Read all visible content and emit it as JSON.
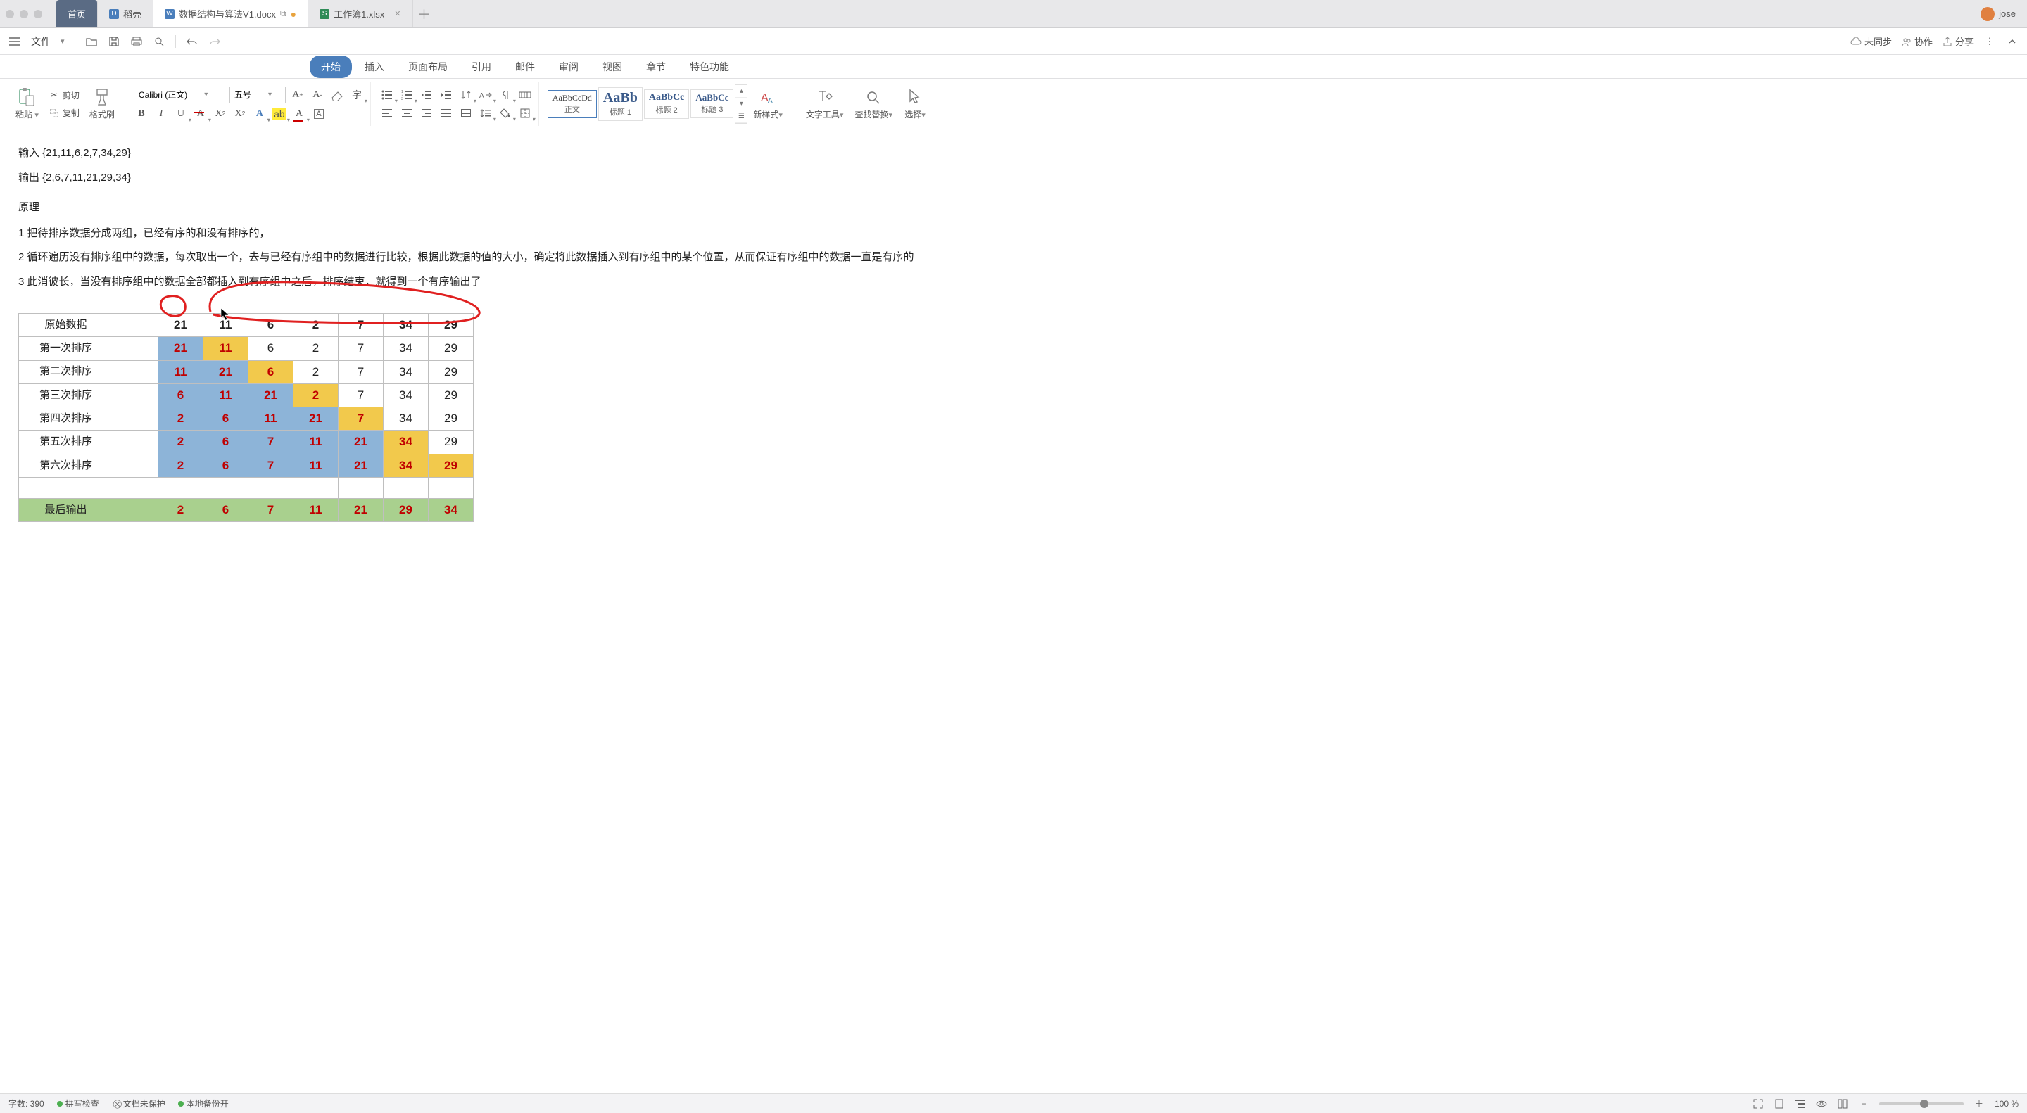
{
  "titlebar": {
    "tabs": {
      "home": "首页",
      "dao": "稻壳",
      "doc": "数据结构与算法V1.docx",
      "sheet": "工作簿1.xlsx"
    },
    "user": "jose"
  },
  "menubar": {
    "file": "文件",
    "sync": "未同步",
    "collab": "协作",
    "share": "分享"
  },
  "ribbon": {
    "tabs": {
      "start": "开始",
      "insert": "插入",
      "layout": "页面布局",
      "ref": "引用",
      "mail": "邮件",
      "review": "审阅",
      "view": "视图",
      "chapter": "章节",
      "special": "特色功能"
    },
    "paste": "粘贴",
    "cut": "剪切",
    "copy": "复制",
    "brush": "格式刷",
    "font_name": "Calibri (正文)",
    "font_size": "五号",
    "styles": {
      "s1": {
        "prev": "AaBbCcDd",
        "label": "正文"
      },
      "s2": {
        "prev": "AaBb",
        "label": "标题 1"
      },
      "s3": {
        "prev": "AaBbCc",
        "label": "标题 2"
      },
      "s4": {
        "prev": "AaBbCc",
        "label": "标题 3"
      }
    },
    "newstyle": "新样式",
    "texttool": "文字工具",
    "findrep": "查找替换",
    "select": "选择"
  },
  "doc": {
    "p_input": "输入  {21,11,6,2,7,34,29}",
    "p_output": "输出  {2,6,7,11,21,29,34}",
    "p_principle": "原理",
    "p1": "1  把待排序数据分成两组，已经有序的和没有排序的，",
    "p2": "2  循环遍历没有排序组中的数据，每次取出一个，去与已经有序组中的数据进行比较，根据此数据的值的大小，确定将此数据插入到有序组中的某个位置，从而保证有序组中的数据一直是有序的",
    "p3": "3  此消彼长，当没有排序组中的数据全部都插入到有序组中之后，排序结束，就得到一个有序输出了",
    "table": {
      "rowh": [
        "原始数据",
        "第一次排序",
        "第二次排序",
        "第三次排序",
        "第四次排序",
        "第五次排序",
        "第六次排序",
        "",
        "最后输出"
      ],
      "rows": [
        [
          {
            "v": "21"
          },
          {
            "v": "11"
          },
          {
            "v": "6"
          },
          {
            "v": "2"
          },
          {
            "v": "7"
          },
          {
            "v": "34"
          },
          {
            "v": "29"
          }
        ],
        [
          {
            "v": "21",
            "bg": "blue",
            "c": "red"
          },
          {
            "v": "11",
            "bg": "yellow",
            "c": "red"
          },
          {
            "v": "6"
          },
          {
            "v": "2"
          },
          {
            "v": "7"
          },
          {
            "v": "34"
          },
          {
            "v": "29"
          }
        ],
        [
          {
            "v": "11",
            "bg": "blue",
            "c": "red"
          },
          {
            "v": "21",
            "bg": "blue",
            "c": "red"
          },
          {
            "v": "6",
            "bg": "yellow",
            "c": "red"
          },
          {
            "v": "2"
          },
          {
            "v": "7"
          },
          {
            "v": "34"
          },
          {
            "v": "29"
          }
        ],
        [
          {
            "v": "6",
            "bg": "blue",
            "c": "red"
          },
          {
            "v": "11",
            "bg": "blue",
            "c": "red"
          },
          {
            "v": "21",
            "bg": "blue",
            "c": "red"
          },
          {
            "v": "2",
            "bg": "yellow",
            "c": "red"
          },
          {
            "v": "7"
          },
          {
            "v": "34"
          },
          {
            "v": "29"
          }
        ],
        [
          {
            "v": "2",
            "bg": "blue",
            "c": "red"
          },
          {
            "v": "6",
            "bg": "blue",
            "c": "red"
          },
          {
            "v": "11",
            "bg": "blue",
            "c": "red"
          },
          {
            "v": "21",
            "bg": "blue",
            "c": "red"
          },
          {
            "v": "7",
            "bg": "yellow",
            "c": "red"
          },
          {
            "v": "34"
          },
          {
            "v": "29"
          }
        ],
        [
          {
            "v": "2",
            "bg": "blue",
            "c": "red"
          },
          {
            "v": "6",
            "bg": "blue",
            "c": "red"
          },
          {
            "v": "7",
            "bg": "blue",
            "c": "red"
          },
          {
            "v": "11",
            "bg": "blue",
            "c": "red"
          },
          {
            "v": "21",
            "bg": "blue",
            "c": "red"
          },
          {
            "v": "34",
            "bg": "yellow",
            "c": "red"
          },
          {
            "v": "29"
          }
        ],
        [
          {
            "v": "2",
            "bg": "blue",
            "c": "red"
          },
          {
            "v": "6",
            "bg": "blue",
            "c": "red"
          },
          {
            "v": "7",
            "bg": "blue",
            "c": "red"
          },
          {
            "v": "11",
            "bg": "blue",
            "c": "red"
          },
          {
            "v": "21",
            "bg": "blue",
            "c": "red"
          },
          {
            "v": "34",
            "bg": "yellow",
            "c": "red"
          },
          {
            "v": "29",
            "bg": "yellow",
            "c": "red"
          }
        ],
        [
          {
            "v": ""
          },
          {
            "v": ""
          },
          {
            "v": ""
          },
          {
            "v": ""
          },
          {
            "v": ""
          },
          {
            "v": ""
          },
          {
            "v": ""
          }
        ],
        [
          {
            "v": "2",
            "bg": "green",
            "c": "red"
          },
          {
            "v": "6",
            "bg": "green",
            "c": "red"
          },
          {
            "v": "7",
            "bg": "green",
            "c": "red"
          },
          {
            "v": "11",
            "bg": "green",
            "c": "red"
          },
          {
            "v": "21",
            "bg": "green",
            "c": "red"
          },
          {
            "v": "29",
            "bg": "green",
            "c": "red"
          },
          {
            "v": "34",
            "bg": "green",
            "c": "red"
          }
        ]
      ]
    }
  },
  "status": {
    "wordcount": "字数: 390",
    "spell": "拼写检查",
    "protect": "文档未保护",
    "backup": "本地备份开",
    "zoom": "100 %"
  }
}
